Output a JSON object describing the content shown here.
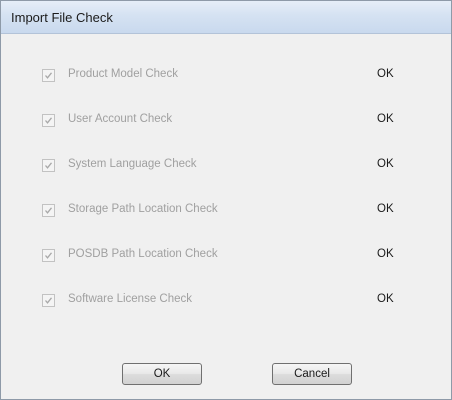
{
  "window": {
    "title": "Import File Check"
  },
  "checks": [
    {
      "label": "Product Model Check",
      "status": "OK",
      "checked": true
    },
    {
      "label": "User Account Check",
      "status": "OK",
      "checked": true
    },
    {
      "label": "System Language Check",
      "status": "OK",
      "checked": true
    },
    {
      "label": "Storage Path Location Check",
      "status": "OK",
      "checked": true
    },
    {
      "label": "POSDB Path Location Check",
      "status": "OK",
      "checked": true
    },
    {
      "label": "Software License Check",
      "status": "OK",
      "checked": true
    }
  ],
  "buttons": {
    "ok_label": "OK",
    "cancel_label": "Cancel"
  },
  "colors": {
    "titlebar": "#d5e2f2",
    "background": "#f0f0f0",
    "disabled_text": "#a0a0a0"
  }
}
